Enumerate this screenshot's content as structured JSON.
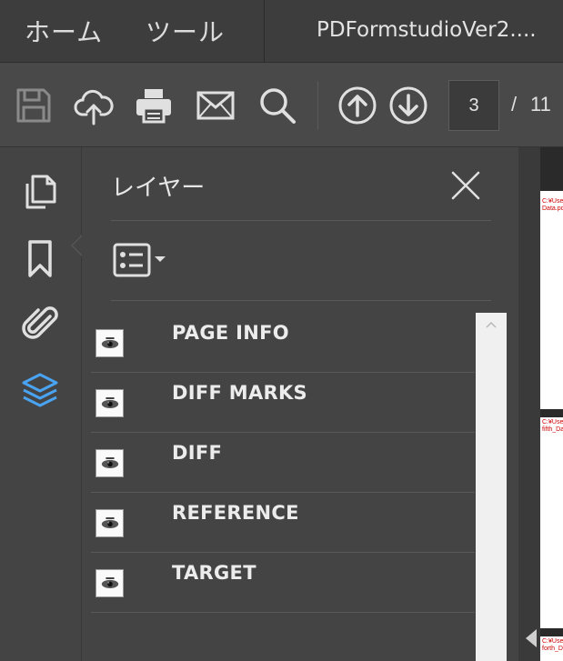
{
  "menu": {
    "home": "ホーム",
    "tools": "ツール",
    "document_title": "PDFormstudioVer2...."
  },
  "toolbar": {
    "icons": [
      "save-icon",
      "cloud-upload-icon",
      "print-icon",
      "mail-icon",
      "search-icon",
      "arrow-up-circle-icon",
      "arrow-down-circle-icon"
    ],
    "page_current": "3",
    "page_separator": "/",
    "page_total": "11"
  },
  "left_rail": {
    "items": [
      "pages-icon",
      "bookmark-icon",
      "attachment-icon",
      "layers-icon"
    ],
    "active": "layers-icon",
    "active_color": "#4aa3f0"
  },
  "layers_panel": {
    "title": "レイヤー",
    "layers": [
      {
        "label": "PAGE INFO"
      },
      {
        "label": "DIFF MARKS"
      },
      {
        "label": "DIFF"
      },
      {
        "label": "REFERENCE"
      },
      {
        "label": "TARGET"
      }
    ]
  },
  "document_strip": {
    "page1_text": [
      "C:¥Use",
      "Data.pd"
    ],
    "page2_text": [
      "C:¥Use",
      "fifth_Da"
    ],
    "page3_text": [
      "C:¥Use",
      "forth_D"
    ]
  }
}
